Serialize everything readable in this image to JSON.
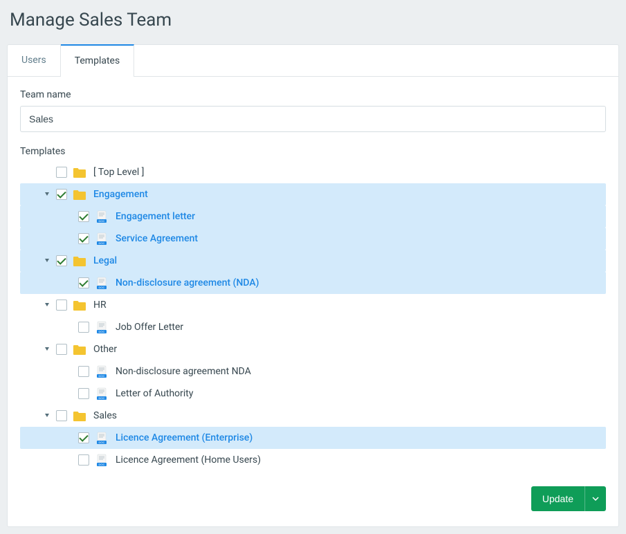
{
  "page_title": "Manage Sales Team",
  "tabs": [
    {
      "label": "Users",
      "active": false
    },
    {
      "label": "Templates",
      "active": true
    }
  ],
  "team_name_label": "Team name",
  "team_name_value": "Sales",
  "templates_label": "Templates",
  "update_button_label": "Update",
  "tree": [
    {
      "depth": 0,
      "expander": "none",
      "checked": false,
      "icon": "folder",
      "label": "[ Top Level ]",
      "selected": false
    },
    {
      "depth": 0,
      "expander": "expanded",
      "checked": true,
      "icon": "folder",
      "label": "Engagement",
      "selected": true
    },
    {
      "depth": 1,
      "expander": "none",
      "checked": true,
      "icon": "doc",
      "label": "Engagement letter",
      "selected": true
    },
    {
      "depth": 1,
      "expander": "none",
      "checked": true,
      "icon": "doc",
      "label": "Service Agreement",
      "selected": true
    },
    {
      "depth": 0,
      "expander": "expanded",
      "checked": true,
      "icon": "folder",
      "label": "Legal",
      "selected": true
    },
    {
      "depth": 1,
      "expander": "none",
      "checked": true,
      "icon": "doc",
      "label": "Non-disclosure agreement (NDA)",
      "selected": true
    },
    {
      "depth": 0,
      "expander": "expanded",
      "checked": false,
      "icon": "folder",
      "label": "HR",
      "selected": false
    },
    {
      "depth": 1,
      "expander": "none",
      "checked": false,
      "icon": "doc",
      "label": "Job Offer Letter",
      "selected": false
    },
    {
      "depth": 0,
      "expander": "expanded",
      "checked": false,
      "icon": "folder",
      "label": "Other",
      "selected": false
    },
    {
      "depth": 1,
      "expander": "none",
      "checked": false,
      "icon": "doc",
      "label": "Non-disclosure agreement NDA",
      "selected": false
    },
    {
      "depth": 1,
      "expander": "none",
      "checked": false,
      "icon": "doc",
      "label": "Letter of Authority",
      "selected": false
    },
    {
      "depth": 0,
      "expander": "expanded",
      "checked": false,
      "icon": "folder",
      "label": "Sales",
      "selected": false
    },
    {
      "depth": 1,
      "expander": "none",
      "checked": true,
      "icon": "doc",
      "label": "Licence Agreement (Enterprise)",
      "selected": true
    },
    {
      "depth": 1,
      "expander": "none",
      "checked": false,
      "icon": "doc",
      "label": "Licence Agreement (Home Users)",
      "selected": false
    }
  ]
}
